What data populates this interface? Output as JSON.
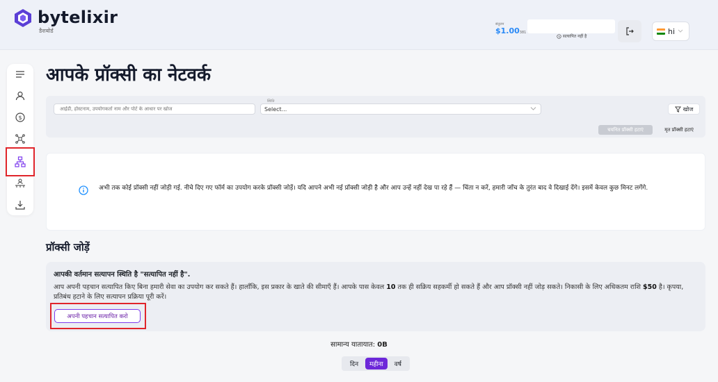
{
  "header": {
    "brand": "bytelixir",
    "brand_subtitle": "डैशबोर्ड",
    "balance_label": "संतुलन",
    "balance_amount": "$1.00",
    "balance_suffix": "381",
    "verify_note": "सत्यापित नहीं है",
    "language": "hi",
    "colors": {
      "accent": "#6d28d9",
      "balance": "#2a8af6",
      "highlight": "#e0242a"
    }
  },
  "sidebar": {
    "items": [
      {
        "icon": "menu-icon"
      },
      {
        "icon": "user-icon"
      },
      {
        "icon": "dollar-icon"
      },
      {
        "icon": "network-icon"
      },
      {
        "icon": "proxy-tree-icon",
        "active": true
      },
      {
        "icon": "referral-icon"
      },
      {
        "icon": "download-icon"
      }
    ]
  },
  "main": {
    "title": "आपके प्रॉक्सी का नेटवर्क",
    "filters": {
      "search_placeholder": "आईडी, होस्टनाम, उपयोगकर्ता नाम और पोर्ट के आधार पर खोज",
      "status_label": "स्थिति",
      "status_value": "Select...",
      "search_button": "खोज",
      "delete_selected": "चयनित प्रॉक्सी हटाएं",
      "delete_dead": "मृत प्रॉक्सी हटाएं"
    },
    "empty_message": "अभी तक कोई प्रॉक्सी नहीं जोड़ी गई. नीचे दिए गए फॉर्म का उपयोग करके प्रॉक्सी जोड़ें। यदि आपने अभी नई प्रॉक्सी जोड़ी है और आप उन्हें नहीं देख पा रहे हैं — चिंता न करें, हमारी जाँच के तुरंत बाद वे दिखाई देंगे। इसमें केवल कुछ मिनट लगेंगे.",
    "add_section_title": "प्रॉक्सी जोड़ें",
    "verification": {
      "heading": "आपकी वर्तमान सत्यापन स्थिति है \"सत्यापित नहीं है\".",
      "body_1": "आप अपनी पहचान सत्यापित किए बिना हमारी सेवा का उपयोग कर सकते हैं। हालाँकि, इस प्रकार के खाते की सीमाएँ हैं। आपके पास केवल ",
      "body_count": "10",
      "body_2": " तक ही सक्रिय सहकर्मी हो सकते हैं और आप प्रॉक्सी नहीं जोड़ सकते। निकासी के लिए अधिकतम राशि ",
      "body_amount": "$50",
      "body_3": " है। कृपया, प्रतिबंध हटाने के लिए सत्यापन प्रक्रिया पूरी करें।",
      "button": "अपनी पहचान सत्यापित करो"
    },
    "traffic_label": "सामान्य यातायात:",
    "traffic_value": "0B",
    "periods": [
      "दिन",
      "महीना",
      "वर्ष"
    ],
    "active_period": "महीना"
  }
}
